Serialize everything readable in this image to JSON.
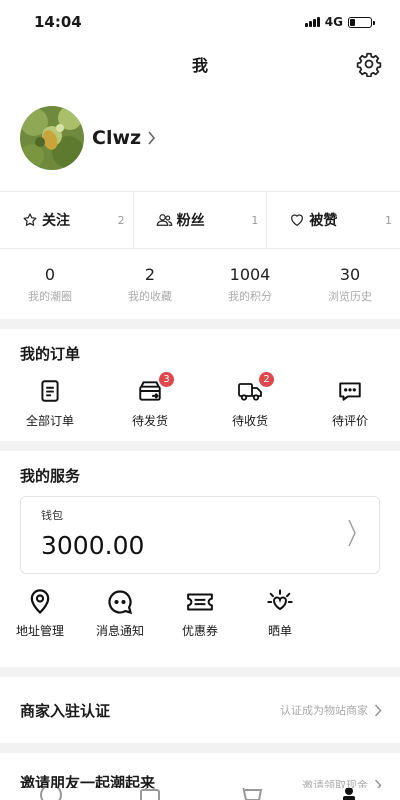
{
  "status_bar": {
    "time": "14:04",
    "network": "4G"
  },
  "nav": {
    "title": "我"
  },
  "profile": {
    "username": "Clwz"
  },
  "social": [
    {
      "label": "关注",
      "count": "2"
    },
    {
      "label": "粉丝",
      "count": "1"
    },
    {
      "label": "被赞",
      "count": "1"
    }
  ],
  "stats": [
    {
      "value": "0",
      "label": "我的潮圈"
    },
    {
      "value": "2",
      "label": "我的收藏"
    },
    {
      "value": "1004",
      "label": "我的积分"
    },
    {
      "value": "30",
      "label": "浏览历史"
    }
  ],
  "orders": {
    "title": "我的订单",
    "items": [
      {
        "label": "全部订单"
      },
      {
        "label": "待发货",
        "badge": "3"
      },
      {
        "label": "待收货",
        "badge": "2"
      },
      {
        "label": "待评价"
      }
    ]
  },
  "services": {
    "title": "我的服务",
    "wallet_label": "钱包",
    "wallet_amount": "3000.00",
    "items": [
      {
        "label": "地址管理"
      },
      {
        "label": "消息通知"
      },
      {
        "label": "优惠券"
      },
      {
        "label": "晒单"
      }
    ]
  },
  "merchant": {
    "title": "商家入驻认证",
    "action": "认证成为物站商家"
  },
  "invite": {
    "title": "邀请朋友一起潮起来",
    "action": "邀请领取现金"
  },
  "colors": {
    "badge": "#e0474a",
    "divider": "#f2f2f2",
    "muted": "#aaaaaa"
  }
}
